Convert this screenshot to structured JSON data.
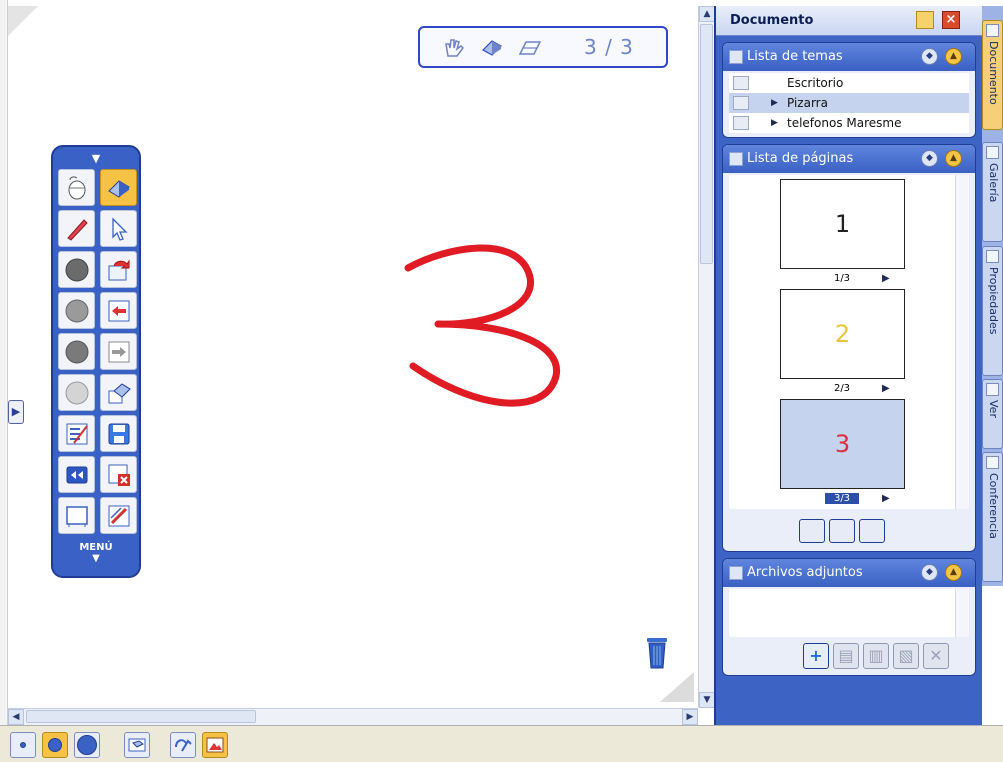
{
  "canvas": {
    "page_counter": "3 / 3",
    "drawing_text": "3"
  },
  "toolbar": {
    "menu_label": "MENÚ",
    "collapse_icon": "chevron-down-icon",
    "tools": [
      {
        "name": "mouse-tool-icon",
        "active": false
      },
      {
        "name": "eraser-tool-icon",
        "active": true
      },
      {
        "name": "pen-tool-icon",
        "active": false
      },
      {
        "name": "pointer-tool-icon",
        "active": false
      },
      {
        "name": "color-dark-icon",
        "active": false
      },
      {
        "name": "redo-icon",
        "active": false
      },
      {
        "name": "color-grey-icon",
        "active": false
      },
      {
        "name": "previous-page-icon",
        "active": false
      },
      {
        "name": "color-darkgrey-icon",
        "active": false
      },
      {
        "name": "next-page-icon",
        "active": false
      },
      {
        "name": "color-light-icon",
        "active": false
      },
      {
        "name": "eraser-clear-icon",
        "active": false
      },
      {
        "name": "line-style-icon",
        "active": false
      },
      {
        "name": "save-icon",
        "active": false
      },
      {
        "name": "rewind-icon",
        "active": false
      },
      {
        "name": "delete-page-icon",
        "active": false
      },
      {
        "name": "blank-page-icon",
        "active": false
      },
      {
        "name": "pen-settings-icon",
        "active": false
      }
    ]
  },
  "panel": {
    "title": "Documento",
    "temas": {
      "title": "Lista de temas",
      "items": [
        {
          "label": "Escritorio",
          "expandable": false,
          "selected": false
        },
        {
          "label": "Pizarra",
          "expandable": true,
          "selected": true
        },
        {
          "label": "telefonos Maresme",
          "expandable": true,
          "selected": false
        }
      ]
    },
    "paginas": {
      "title": "Lista de páginas",
      "pages": [
        {
          "number": "1",
          "label": "1/3",
          "color": "#222222",
          "selected": false
        },
        {
          "number": "2",
          "label": "2/3",
          "color": "#e8c53a",
          "selected": false
        },
        {
          "number": "3",
          "label": "3/3",
          "color": "#d9303c",
          "selected": true
        }
      ]
    },
    "adjuntos": {
      "title": "Archivos adjuntos"
    }
  },
  "sidetabs": [
    {
      "label": "Documento",
      "active": true
    },
    {
      "label": "Galería",
      "active": false
    },
    {
      "label": "Propiedades",
      "active": false
    },
    {
      "label": "Ver",
      "active": false
    },
    {
      "label": "Conferencia",
      "active": false
    }
  ],
  "colors": {
    "panel_blue": "#3d63c4",
    "active_tool": "#f6c245",
    "ink_red": "#e01b24"
  }
}
